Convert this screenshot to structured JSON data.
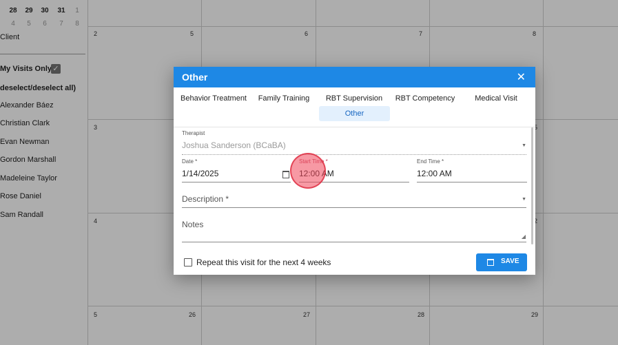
{
  "mini_calendar": {
    "row1": [
      "28",
      "29",
      "30",
      "31",
      "1"
    ],
    "row2": [
      "4",
      "5",
      "6",
      "7",
      "8"
    ]
  },
  "sidebar": {
    "client_label": "Client",
    "my_visits_label": "My Visits Only",
    "select_all_label": "deselect/deselect all)",
    "therapists": [
      "Alexander Báez",
      "Christian Clark",
      "Evan Newman",
      "Gordon Marshall",
      "Madeleine Taylor",
      "Rose Daniel",
      "Sam Randall"
    ]
  },
  "calendar": {
    "row1_days": [
      "2",
      "5",
      "6",
      "7",
      "8"
    ],
    "row2_days": [
      "3",
      "",
      "",
      "",
      "5"
    ],
    "row3_days": [
      "4",
      "",
      "",
      "",
      "2"
    ],
    "row4_days": [
      "5",
      "26",
      "27",
      "28",
      "29"
    ]
  },
  "dialog": {
    "title": "Other",
    "close_glyph": "✕",
    "tabs": [
      "Behavior Treatment",
      "Family Training",
      "RBT Supervision",
      "RBT Competency",
      "Medical Visit",
      "Other"
    ],
    "therapist": {
      "label": "Therapist",
      "value": "Joshua Sanderson (BCaBA)"
    },
    "date": {
      "label": "Date *",
      "value": "1/14/2025"
    },
    "start_time": {
      "label": "Start Time *",
      "value": "12:00 AM"
    },
    "end_time": {
      "label": "End Time *",
      "value": "12:00 AM"
    },
    "description": {
      "placeholder": "Description *"
    },
    "notes": {
      "placeholder": "Notes"
    },
    "repeat_label": "Repeat this visit for the next 4 weeks",
    "save_label": "SAVE"
  },
  "colors": {
    "accent": "#1e88e5",
    "active_tab_bg": "#e3f0fd",
    "click_marker": "#f0465a"
  }
}
